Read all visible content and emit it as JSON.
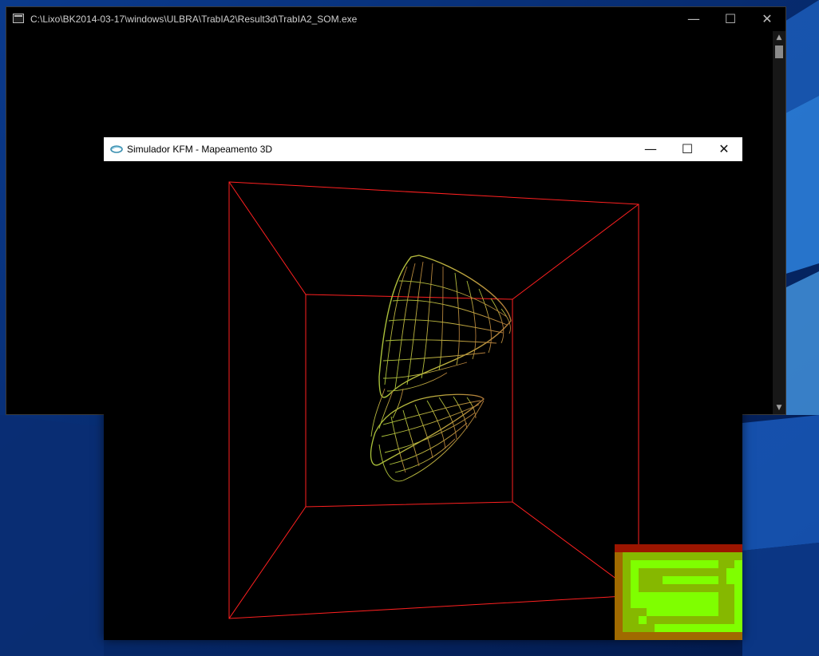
{
  "console_window": {
    "title": "C:\\Lixo\\BK2014-03-17\\windows\\ULBRA\\TrabIA2\\Result3d\\TrabIA2_SOM.exe",
    "icon": "console-icon",
    "controls": {
      "minimize": "—",
      "maximize": "☐",
      "close": "✕"
    },
    "scroll_up": "▲",
    "scroll_down": "▼"
  },
  "sim_window": {
    "title": "Simulador KFM - Mapeamento 3D",
    "icon": "opengl-app-icon",
    "controls": {
      "minimize": "—",
      "maximize": "☐",
      "close": "✕"
    }
  },
  "scene": {
    "box_color": "#ff2020",
    "mesh_color_light": "#a9c23a",
    "mesh_color_dark": "#b07a3a",
    "rendering": "wireframe"
  },
  "som_map": {
    "cols": 16,
    "rows": 12,
    "palette": {
      "0": "#7fff00",
      "1": "#86b800",
      "2": "#a06a00",
      "3": "#9c1500"
    },
    "cells": [
      "3333333333333333",
      "2111111111111111",
      "2100000000000110",
      "2101111111111100",
      "2101110000000100",
      "2101111111111110",
      "2100000000000110",
      "2100000000000110",
      "2111000000000110",
      "2110111111111110",
      "2111100000000000",
      "2222222222222222"
    ]
  }
}
